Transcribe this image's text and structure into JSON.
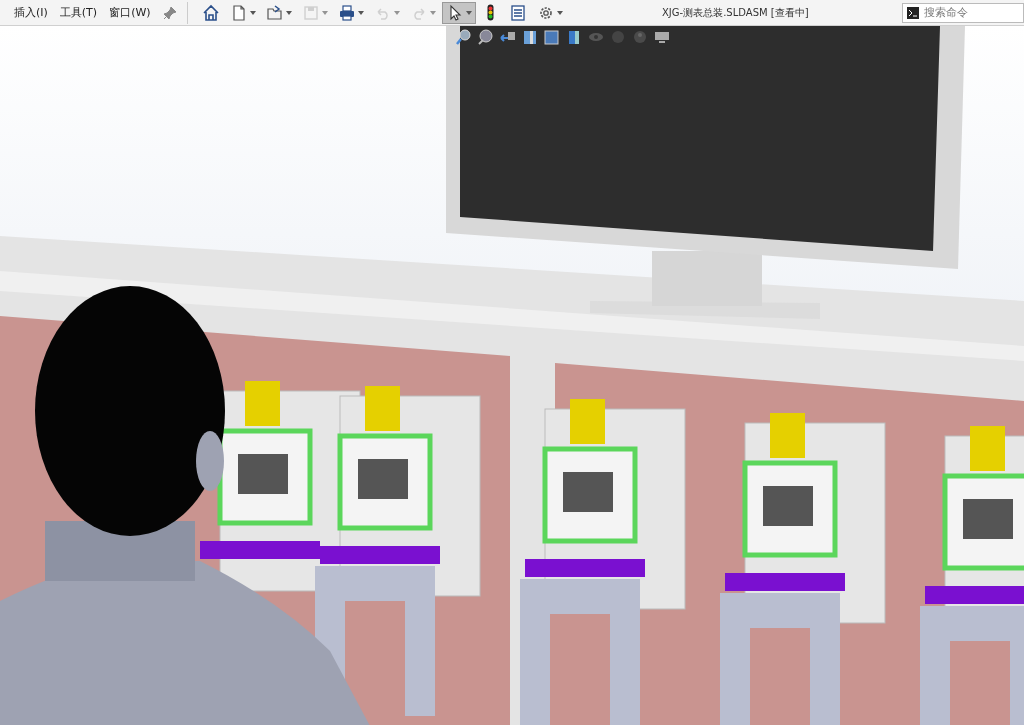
{
  "menus": [
    {
      "label": "插入(I)"
    },
    {
      "label": "工具(T)"
    },
    {
      "label": "窗口(W)"
    }
  ],
  "toolbar": [
    {
      "kind": "home",
      "dropdown": false,
      "disabled": false,
      "selected": false
    },
    {
      "kind": "new",
      "dropdown": true,
      "disabled": false,
      "selected": false
    },
    {
      "kind": "open",
      "dropdown": true,
      "disabled": false,
      "selected": false
    },
    {
      "kind": "save",
      "dropdown": true,
      "disabled": true,
      "selected": false
    },
    {
      "kind": "print",
      "dropdown": true,
      "disabled": false,
      "selected": false
    },
    {
      "kind": "undo",
      "dropdown": true,
      "disabled": true,
      "selected": false
    },
    {
      "kind": "redo",
      "dropdown": true,
      "disabled": true,
      "selected": false
    },
    {
      "kind": "select",
      "dropdown": true,
      "disabled": false,
      "selected": true
    },
    {
      "kind": "traffic",
      "dropdown": false,
      "disabled": false,
      "selected": false
    },
    {
      "kind": "list",
      "dropdown": false,
      "disabled": false,
      "selected": false
    },
    {
      "kind": "gear",
      "dropdown": true,
      "disabled": false,
      "selected": false
    }
  ],
  "window": {
    "title": "XJG-测表总装.SLDASM [查看中]"
  },
  "search": {
    "placeholder": "搜索命令"
  }
}
